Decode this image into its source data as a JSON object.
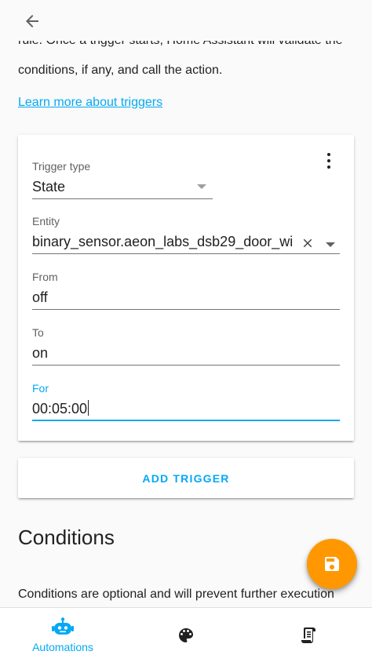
{
  "header": {
    "back_icon": "arrow-left-icon"
  },
  "intro": {
    "clipped_line": "rule. Once a trigger starts, Home Assistant will validate the",
    "line2": "conditions, if any, and call the action.",
    "learn_more": "Learn more about triggers"
  },
  "trigger_card": {
    "menu_icon": "dots-vertical-icon",
    "trigger_type": {
      "label": "Trigger type",
      "value": "State"
    },
    "entity": {
      "label": "Entity",
      "value": "binary_sensor.aeon_labs_dsb29_door_wi",
      "clear_icon": "close-icon"
    },
    "from": {
      "label": "From",
      "value": "off"
    },
    "to": {
      "label": "To",
      "value": "on"
    },
    "for": {
      "label": "For",
      "value": "00:05:00"
    }
  },
  "add_trigger": {
    "label": "ADD TRIGGER"
  },
  "conditions": {
    "title": "Conditions",
    "description": "Conditions are optional and will prevent further execution"
  },
  "fab": {
    "icon": "save-icon"
  },
  "bottom_nav": {
    "items": [
      {
        "label": "Automations",
        "icon": "robot-icon",
        "active": true
      },
      {
        "label": "",
        "icon": "palette-icon",
        "active": false
      },
      {
        "label": "",
        "icon": "script-icon",
        "active": false
      }
    ]
  },
  "colors": {
    "accent": "#03a9f4",
    "fab": "#ff9800",
    "text": "#212121"
  }
}
